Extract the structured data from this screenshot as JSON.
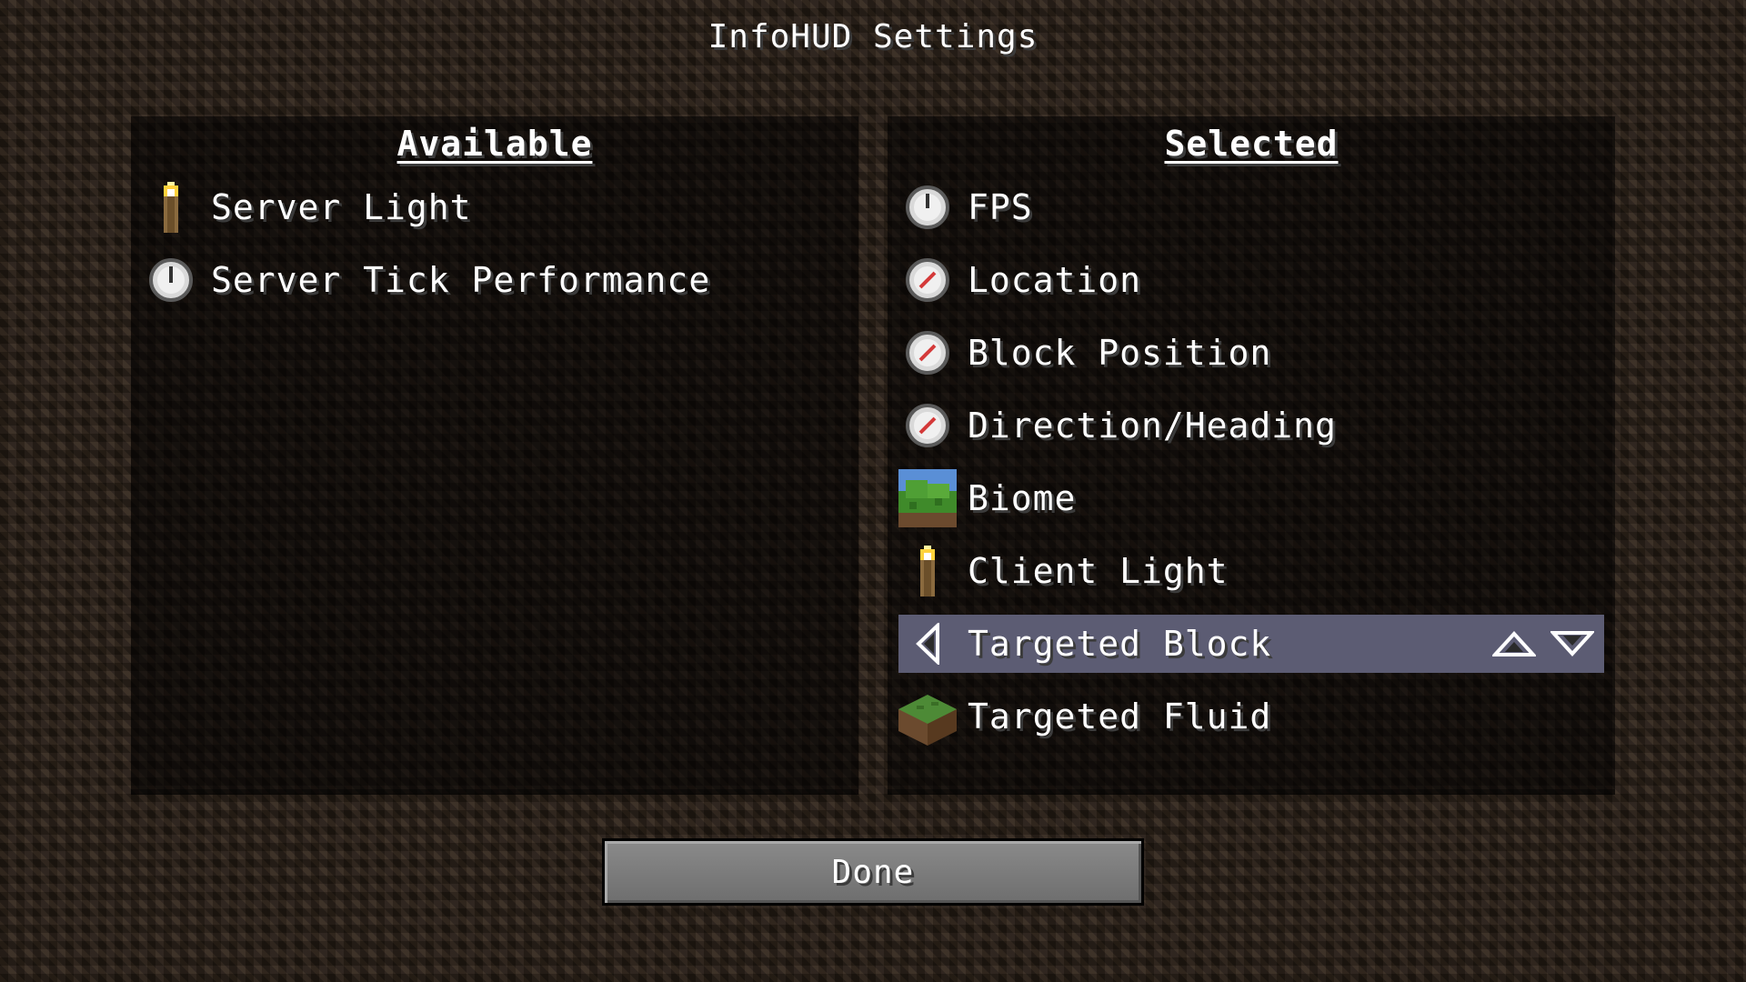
{
  "title": "InfoHUD Settings",
  "available": {
    "header": "Available",
    "items": [
      {
        "label": "Server Light",
        "icon": "torch-icon"
      },
      {
        "label": "Server Tick Performance",
        "icon": "clock-icon"
      }
    ]
  },
  "selected": {
    "header": "Selected",
    "items": [
      {
        "label": "FPS",
        "icon": "clock-icon"
      },
      {
        "label": "Location",
        "icon": "compass-icon"
      },
      {
        "label": "Block Position",
        "icon": "compass-icon"
      },
      {
        "label": "Direction/Heading",
        "icon": "compass-icon"
      },
      {
        "label": "Biome",
        "icon": "grass-block-icon"
      },
      {
        "label": "Client Light",
        "icon": "torch-icon"
      },
      {
        "label": "Targeted Block",
        "icon": "arrow-left-icon",
        "highlighted": true
      },
      {
        "label": "Targeted Fluid",
        "icon": "grass-block-icon"
      }
    ]
  },
  "done_label": "Done",
  "colors": {
    "highlight": "#5c5c73",
    "background": "#2b2119",
    "text": "#ffffff"
  }
}
